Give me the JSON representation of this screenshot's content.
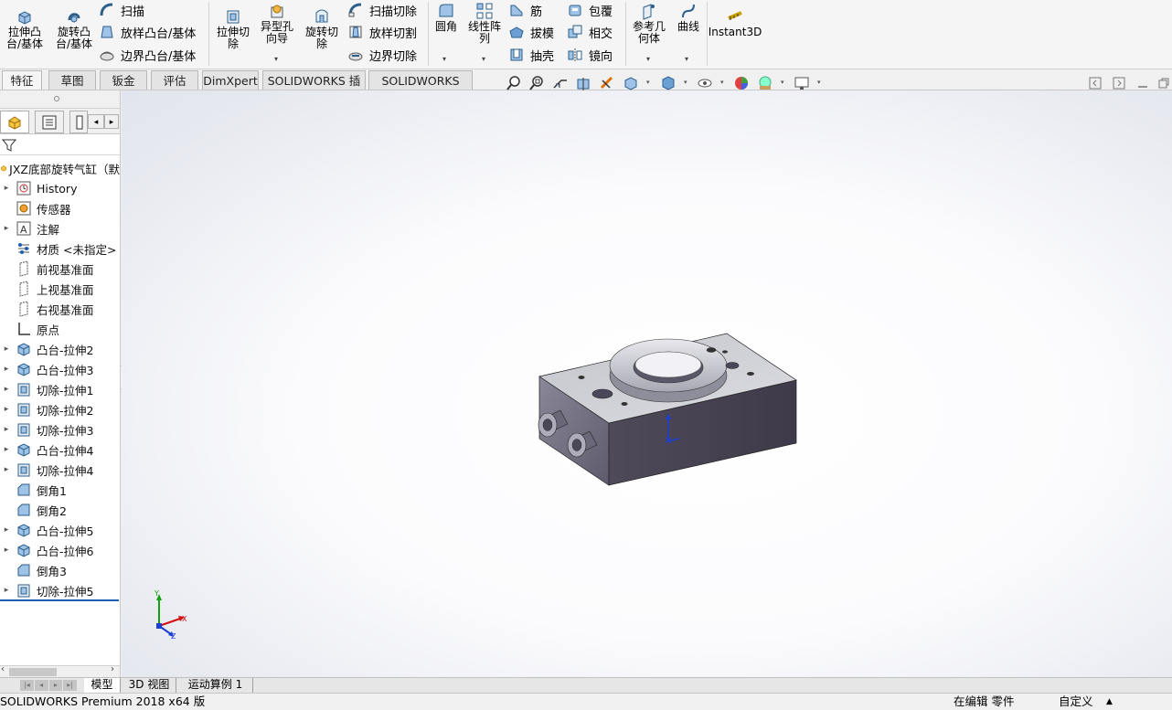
{
  "ribbon": {
    "extrude_boss": "拉伸凸\n台/基体",
    "revolve_boss": "旋转凸\n台/基体",
    "sweep": "扫描",
    "loft_boss": "放样凸台/基体",
    "boundary_boss": "边界凸台/基体",
    "extrude_cut": "拉伸切\n除",
    "hole_wizard": "异型孔\n向导",
    "revolve_cut": "旋转切\n除",
    "swept_cut": "扫描切除",
    "lofted_cut": "放样切割",
    "boundary_cut": "边界切除",
    "fillet": "圆角",
    "linear_pattern": "线性阵\n列",
    "rib": "筋",
    "draft": "拔模",
    "shell": "抽壳",
    "wrap": "包覆",
    "intersect": "相交",
    "mirror": "镜向",
    "ref_geometry": "参考几\n何体",
    "curves": "曲线",
    "instant3d": "Instant3D"
  },
  "tabs": [
    "特征",
    "草图",
    "钣金",
    "评估",
    "DimXpert",
    "SOLIDWORKS 插件",
    "SOLIDWORKS MBD"
  ],
  "tree": {
    "root": "JXZ底部旋转气缸（默",
    "items": [
      {
        "label": "History",
        "icon": "history-icon",
        "expand": true
      },
      {
        "label": "传感器",
        "icon": "sensor-icon",
        "expand": false
      },
      {
        "label": "注解",
        "icon": "annotation-icon",
        "expand": true
      },
      {
        "label": "材质 <未指定>",
        "icon": "material-icon",
        "expand": false
      },
      {
        "label": "前视基准面",
        "icon": "plane-icon",
        "expand": false
      },
      {
        "label": "上视基准面",
        "icon": "plane-icon",
        "expand": false
      },
      {
        "label": "右视基准面",
        "icon": "plane-icon",
        "expand": false
      },
      {
        "label": "原点",
        "icon": "origin-icon",
        "expand": false
      },
      {
        "label": "凸台-拉伸2",
        "icon": "boss-extrude-icon",
        "expand": true
      },
      {
        "label": "凸台-拉伸3",
        "icon": "boss-extrude-icon",
        "expand": true
      },
      {
        "label": "切除-拉伸1",
        "icon": "cut-extrude-icon",
        "expand": true
      },
      {
        "label": "切除-拉伸2",
        "icon": "cut-extrude-icon",
        "expand": true
      },
      {
        "label": "切除-拉伸3",
        "icon": "cut-extrude-icon",
        "expand": true
      },
      {
        "label": "凸台-拉伸4",
        "icon": "boss-extrude-icon",
        "expand": true
      },
      {
        "label": "切除-拉伸4",
        "icon": "cut-extrude-icon",
        "expand": true
      },
      {
        "label": "倒角1",
        "icon": "chamfer-icon",
        "expand": false
      },
      {
        "label": "倒角2",
        "icon": "chamfer-icon",
        "expand": false
      },
      {
        "label": "凸台-拉伸5",
        "icon": "boss-extrude-icon",
        "expand": true
      },
      {
        "label": "凸台-拉伸6",
        "icon": "boss-extrude-icon",
        "expand": true
      },
      {
        "label": "倒角3",
        "icon": "chamfer-icon",
        "expand": false
      },
      {
        "label": "切除-拉伸5",
        "icon": "cut-extrude-icon",
        "expand": true
      }
    ]
  },
  "triad": {
    "x": "X",
    "y": "Y",
    "z": "Z"
  },
  "bottom_tabs": [
    "模型",
    "3D 视图",
    "运动算例 1"
  ],
  "status": {
    "app": "SOLIDWORKS Premium 2018 x64 版",
    "editing": "在编辑 零件",
    "units": "自定义"
  },
  "colors": {
    "part_side": "#4a4556",
    "part_top": "#d0d0d8",
    "accent_blue": "#1a5fb4"
  }
}
